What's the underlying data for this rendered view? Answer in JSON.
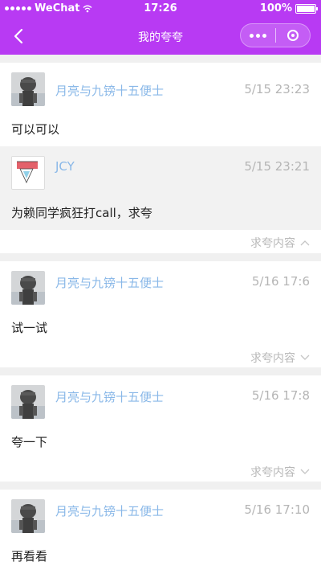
{
  "status_bar": {
    "carrier": "WeChat",
    "time": "17:26",
    "battery": "100%",
    "battery_level": 1.0
  },
  "nav": {
    "title": "我的夸夸",
    "back_icon": "chevron-left-icon",
    "more_icon": "more-dots-icon",
    "close_icon": "target-icon"
  },
  "colors": {
    "header": "#b83af3",
    "username": "#8ab8e8",
    "time": "#b5b5b5",
    "toggle": "#b8b8b8"
  },
  "cards": [
    {
      "user": "月亮与九镑十五便士",
      "time": "5/15 23:23",
      "text": "可以可以",
      "reply": {
        "user": "JCY",
        "time": "5/15 23:21",
        "text": "为赖同学疯狂打call，求夸"
      },
      "toggle_label": "求夸内容",
      "toggle_state": "expanded"
    },
    {
      "user": "月亮与九镑十五便士",
      "time": "5/16 17:6",
      "text": "试一试",
      "toggle_label": "求夸内容",
      "toggle_state": "collapsed"
    },
    {
      "user": "月亮与九镑十五便士",
      "time": "5/16 17:8",
      "text": "夸一下",
      "toggle_label": "求夸内容",
      "toggle_state": "collapsed"
    },
    {
      "user": "月亮与九镑十五便士",
      "time": "5/16 17:10",
      "text": "再看看"
    }
  ]
}
